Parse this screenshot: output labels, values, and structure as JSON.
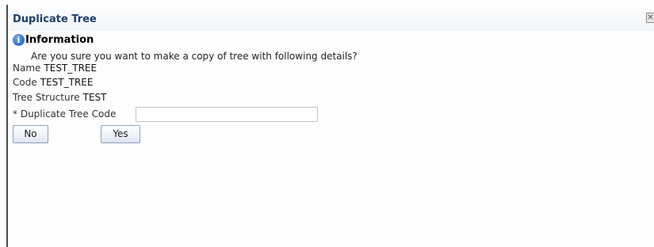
{
  "dialog": {
    "title": "Duplicate Tree",
    "close_glyph": "✕",
    "close_icon": "close-icon"
  },
  "info": {
    "icon": "info-icon",
    "icon_glyph": "i",
    "title": "Information",
    "message": "Are you sure you want to make a copy of tree with following details?"
  },
  "fields": {
    "name": {
      "label": "Name",
      "value": "TEST_TREE"
    },
    "code": {
      "label": "Code",
      "value": "TEST_TREE"
    },
    "tree_structure": {
      "label": "Tree Structure",
      "value": "TEST"
    },
    "duplicate_code": {
      "required_mark": "*",
      "label": "Duplicate Tree Code",
      "value": "",
      "placeholder": ""
    }
  },
  "buttons": {
    "no_label": "No",
    "yes_label": "Yes"
  },
  "colors": {
    "title_text": "#1d3e6e",
    "info_icon": "#2a6bc7",
    "button_border": "#8aa0bd"
  }
}
